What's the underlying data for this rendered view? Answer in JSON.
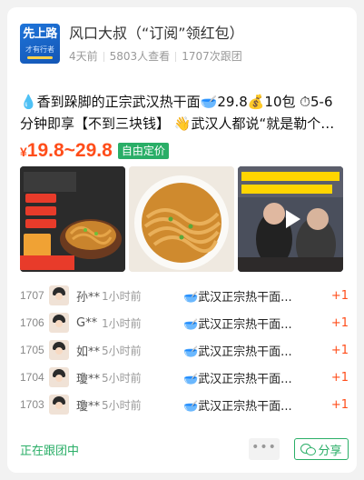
{
  "header": {
    "logo_text_top": "先上路",
    "logo_text_bottom": "才有行者",
    "title": "风口大叔（“订阅”领红包）",
    "ago": "4天前",
    "views": "5803人查看",
    "joined": "1707次跟团"
  },
  "product": {
    "description": "💧香到跺脚的正宗武汉热干面🥣29.8💰10包 ⏱5-6分钟即享【不到三块钱】 👋武汉人都说“就是勒个…",
    "price_symbol": "¥",
    "price": "19.8~29.8",
    "tag": "自由定价"
  },
  "orders": [
    {
      "num": "1707",
      "name": "孙**",
      "time": "1小时前",
      "item": "🥣武汉正宗热干面...",
      "qty": "+1"
    },
    {
      "num": "1706",
      "name": "G**",
      "time": "1小时前",
      "item": "🥣武汉正宗热干面...",
      "qty": "+1"
    },
    {
      "num": "1705",
      "name": "如**",
      "time": "5小时前",
      "item": "🥣武汉正宗热干面...",
      "qty": "+1"
    },
    {
      "num": "1704",
      "name": "瓊**",
      "time": "5小时前",
      "item": "🥣武汉正宗热干面...",
      "qty": "+1"
    },
    {
      "num": "1703",
      "name": "瓊**",
      "time": "5小时前",
      "item": "🥣武汉正宗热干面...",
      "qty": "+1"
    }
  ],
  "footer": {
    "status": "正在跟团中",
    "more": "•••",
    "share": "分享"
  }
}
